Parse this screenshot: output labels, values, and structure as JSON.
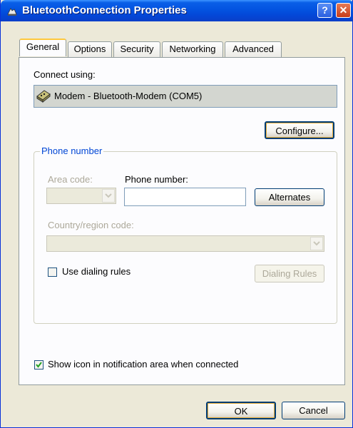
{
  "window": {
    "title": "BluetoothConnection Properties",
    "help_glyph": "?",
    "close_glyph": "✕",
    "icon": "network-connection-icon"
  },
  "tabs": [
    {
      "label": "General",
      "active": true
    },
    {
      "label": "Options",
      "active": false
    },
    {
      "label": "Security",
      "active": false
    },
    {
      "label": "Networking",
      "active": false
    },
    {
      "label": "Advanced",
      "active": false
    }
  ],
  "general": {
    "connect_using_label": "Connect using:",
    "device_name": "Modem - Bluetooth-Modem (COM5)",
    "device_icon": "modem-icon",
    "configure_button": "Configure...",
    "phone_group_title": "Phone number",
    "area_code_label": "Area code:",
    "area_code_value": "",
    "phone_number_label": "Phone number:",
    "phone_number_value": "",
    "alternates_button": "Alternates",
    "country_label": "Country/region code:",
    "country_value": "",
    "use_dialing_rules_label": "Use dialing rules",
    "use_dialing_rules_checked": false,
    "dialing_rules_button": "Dialing Rules",
    "show_icon_label": "Show icon in notification area when connected",
    "show_icon_checked": true
  },
  "footer": {
    "ok_button": "OK",
    "cancel_button": "Cancel"
  },
  "colors": {
    "titlebar": "#0353e0",
    "face": "#ece9d8",
    "group_title": "#0046d5",
    "check": "#21a121"
  }
}
